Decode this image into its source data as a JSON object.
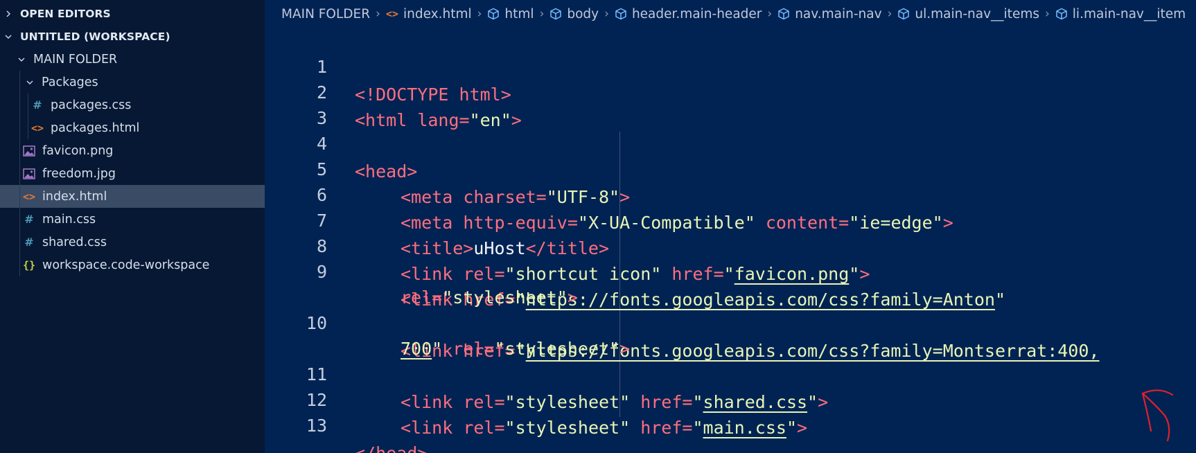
{
  "sidebar": {
    "open_editors": "OPEN EDITORS",
    "workspace": "UNTITLED (WORKSPACE)",
    "main_folder": "MAIN FOLDER",
    "packages_folder": "Packages",
    "files": [
      {
        "name": "packages.css",
        "icon": "css-hash-icon"
      },
      {
        "name": "packages.html",
        "icon": "html-icon"
      },
      {
        "name": "favicon.png",
        "icon": "image-icon"
      },
      {
        "name": "freedom.jpg",
        "icon": "image-icon"
      },
      {
        "name": "index.html",
        "icon": "html-icon",
        "selected": true
      },
      {
        "name": "main.css",
        "icon": "css-hash-icon"
      },
      {
        "name": "shared.css",
        "icon": "css-hash-icon"
      },
      {
        "name": "workspace.code-workspace",
        "icon": "json-braces-icon"
      }
    ],
    "icons": {
      "hash": "#",
      "html": "<>",
      "json": "{}"
    }
  },
  "breadcrumb": [
    "MAIN FOLDER",
    "index.html",
    "html",
    "body",
    "header.main-header",
    "nav.main-nav",
    "ul.main-nav__items",
    "li.main-nav__item"
  ],
  "code": {
    "line_numbers": [
      "1",
      "2",
      "3",
      "4",
      "5",
      "6",
      "7",
      "8",
      "9",
      "10",
      "11",
      "12",
      "13"
    ],
    "l1": {
      "tag": "<!DOCTYPE html>"
    },
    "l2": {
      "open": "<html",
      "attr": " lang=",
      "val": "\"en\"",
      "close": ">"
    },
    "l4": {
      "tag": "<head>"
    },
    "l5": {
      "open": "<meta",
      "attr": " charset=",
      "val": "\"UTF-8\"",
      "close": ">"
    },
    "l6": {
      "open": "<meta",
      "attr1": " http-equiv=",
      "val1": "\"X-UA-Compatible\"",
      "attr2": " content=",
      "val2": "\"ie=edge\"",
      "close": ">"
    },
    "l7": {
      "open": "<title>",
      "text": "uHost",
      "close": "</title>"
    },
    "l8": {
      "open": "<link",
      "attr1": " rel=",
      "val1": "\"shortcut icon\"",
      "attr2": " href=",
      "q1": "\"",
      "url": "favicon.png",
      "q2": "\"",
      "close": ">"
    },
    "l9a": {
      "open": "<link",
      "attr": " href=",
      "q1": "\"",
      "url": "https://fonts.googleapis.com/css?family=Anton",
      "q2": "\""
    },
    "l9b": {
      "attr": "rel=",
      "val": "\"stylesheet\"",
      "close": ">"
    },
    "l10a": {
      "open": "<link",
      "attr": " href=",
      "q1": "\"",
      "url": "https://fonts.googleapis.com/css?family=Montserrat:400,"
    },
    "l10b": {
      "url": "700",
      "q2": "\"",
      "attr": " rel=",
      "val": "\"stylesheet\"",
      "close": ">"
    },
    "l11": {
      "open": "<link",
      "attr1": " rel=",
      "val1": "\"stylesheet\"",
      "attr2": " href=",
      "q1": "\"",
      "url": "shared.css",
      "q2": "\"",
      "close": ">"
    },
    "l12": {
      "open": "<link",
      "attr1": " rel=",
      "val1": "\"stylesheet\"",
      "attr2": " href=",
      "q1": "\"",
      "url": "main.css",
      "q2": "\"",
      "close": ">"
    },
    "l13": {
      "tag": "</head>"
    }
  },
  "colors": {
    "editor_bg": "#012354",
    "sidebar_bg": "#061833",
    "selected_row": "#3a4b66",
    "tag": "#ff6f7e",
    "string": "#e8f5b4",
    "annotation": "#e0202a"
  }
}
